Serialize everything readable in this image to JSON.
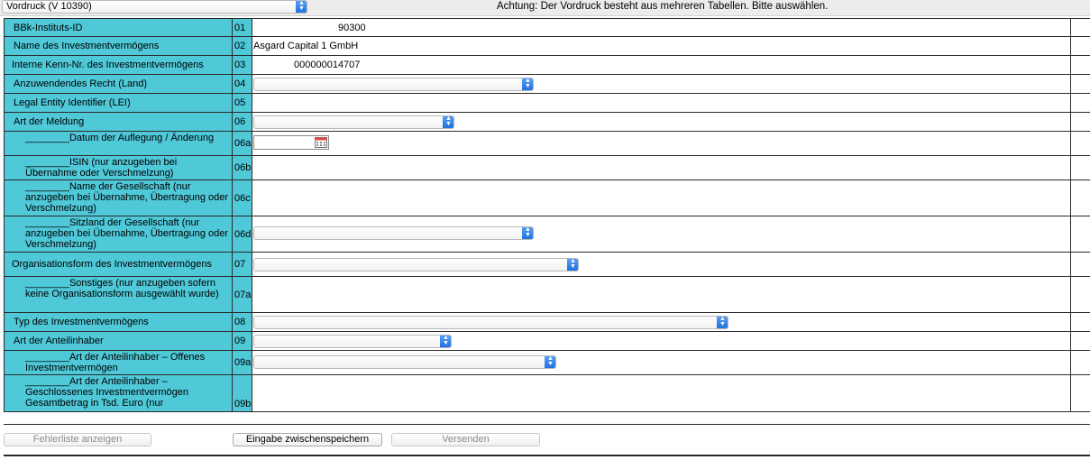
{
  "header": {
    "form_select": "Vordruck (V 10390)",
    "warning": "Achtung: Der Vordruck besteht aus mehreren Tabellen. Bitte auswählen."
  },
  "rows": [
    {
      "label": "BBk-Instituts-ID",
      "num": "01",
      "value": "90300"
    },
    {
      "label": "Name des Investmentvermögens",
      "num": "02",
      "value": "Asgard Capital 1 GmbH"
    },
    {
      "label": "Interne Kenn-Nr. des Investmentvermögens",
      "num": "03",
      "value": "000000014707"
    },
    {
      "label": "Anzuwendendes Recht (Land)",
      "num": "04",
      "value": ""
    },
    {
      "label": "Legal Entity Identifier (LEI)",
      "num": "05",
      "value": ""
    },
    {
      "label": "Art der Meldung",
      "num": "06",
      "value": ""
    },
    {
      "label": "________Datum der Auflegung / Änderung",
      "num": "06a",
      "value": ""
    },
    {
      "label": "________ISIN (nur anzugeben bei Übernahme oder Verschmelzung)",
      "num": "06b",
      "value": ""
    },
    {
      "label": "________Name der Gesellschaft (nur anzugeben bei Übernahme, Übertragung oder Verschmelzung)",
      "num": "06c",
      "value": ""
    },
    {
      "label": "________Sitzland der Gesellschaft (nur anzugeben bei Übernahme, Übertragung oder Verschmelzung)",
      "num": "06d",
      "value": ""
    },
    {
      "label": "Organisationsform des Investmentvermögens",
      "num": "07",
      "value": ""
    },
    {
      "label": "________Sonstiges (nur anzugeben sofern keine Organisationsform ausgewählt wurde)",
      "num": "07a",
      "value": ""
    },
    {
      "label": "Typ des Investmentvermögens",
      "num": "08",
      "value": ""
    },
    {
      "label": "Art der Anteilinhaber",
      "num": "09",
      "value": ""
    },
    {
      "label": "________Art der Anteilinhaber – Offenes Investmentvermögen",
      "num": "09a",
      "value": ""
    },
    {
      "label": "________Art der Anteilinhaber – Geschlossenes Investmentvermögen Gesamtbetrag in Tsd. Euro (nur",
      "num": "09b",
      "value": ""
    }
  ],
  "buttons": {
    "errors": "Fehlerliste anzeigen",
    "save": "Eingabe zwischenspeichern",
    "send": "Versenden"
  },
  "icons": {
    "select_arrows": "updown-chevron-icon",
    "calendar": "calendar-icon"
  },
  "colors": {
    "label_bg": "#4fc8d8",
    "select_accent": "#1a6fe0"
  }
}
